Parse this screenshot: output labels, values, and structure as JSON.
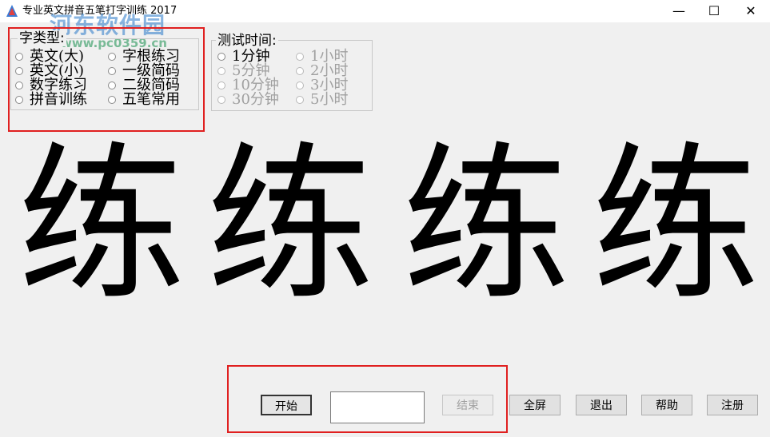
{
  "window": {
    "title": "专业英文拼音五笔打字训练 2017",
    "minimize_glyph": "—",
    "maximize_glyph": "☐",
    "close_glyph": "✕"
  },
  "watermark": {
    "site_name": "河东软件园",
    "site_url": "www.pc0359.cn"
  },
  "type_group": {
    "legend": "字类型:",
    "options": [
      {
        "label": "英文(大)",
        "selected": false
      },
      {
        "label": "字根练习",
        "selected": false
      },
      {
        "label": "英文(小)",
        "selected": false
      },
      {
        "label": "一级简码",
        "selected": false
      },
      {
        "label": "数字练习",
        "selected": false
      },
      {
        "label": "二级简码",
        "selected": false
      },
      {
        "label": "拼音训练",
        "selected": false
      },
      {
        "label": "五笔常用",
        "selected": false
      }
    ]
  },
  "time_group": {
    "legend": "测试时间:",
    "options": [
      {
        "label": "1分钟",
        "enabled": true
      },
      {
        "label": "1小时",
        "enabled": false
      },
      {
        "label": "5分钟",
        "enabled": false
      },
      {
        "label": "2小时",
        "enabled": false
      },
      {
        "label": "10分钟",
        "enabled": false
      },
      {
        "label": "3小时",
        "enabled": false
      },
      {
        "label": "30分钟",
        "enabled": false
      },
      {
        "label": "5小时",
        "enabled": false
      }
    ]
  },
  "display": {
    "characters": [
      "练",
      "练",
      "练",
      "练"
    ]
  },
  "input": {
    "value": ""
  },
  "buttons": {
    "start": "开始",
    "end": "结束",
    "fullscreen": "全屏",
    "exit": "退出",
    "help": "帮助",
    "register": "注册"
  },
  "colors": {
    "highlight_box": "#e02020",
    "background": "#f0f0f0"
  }
}
